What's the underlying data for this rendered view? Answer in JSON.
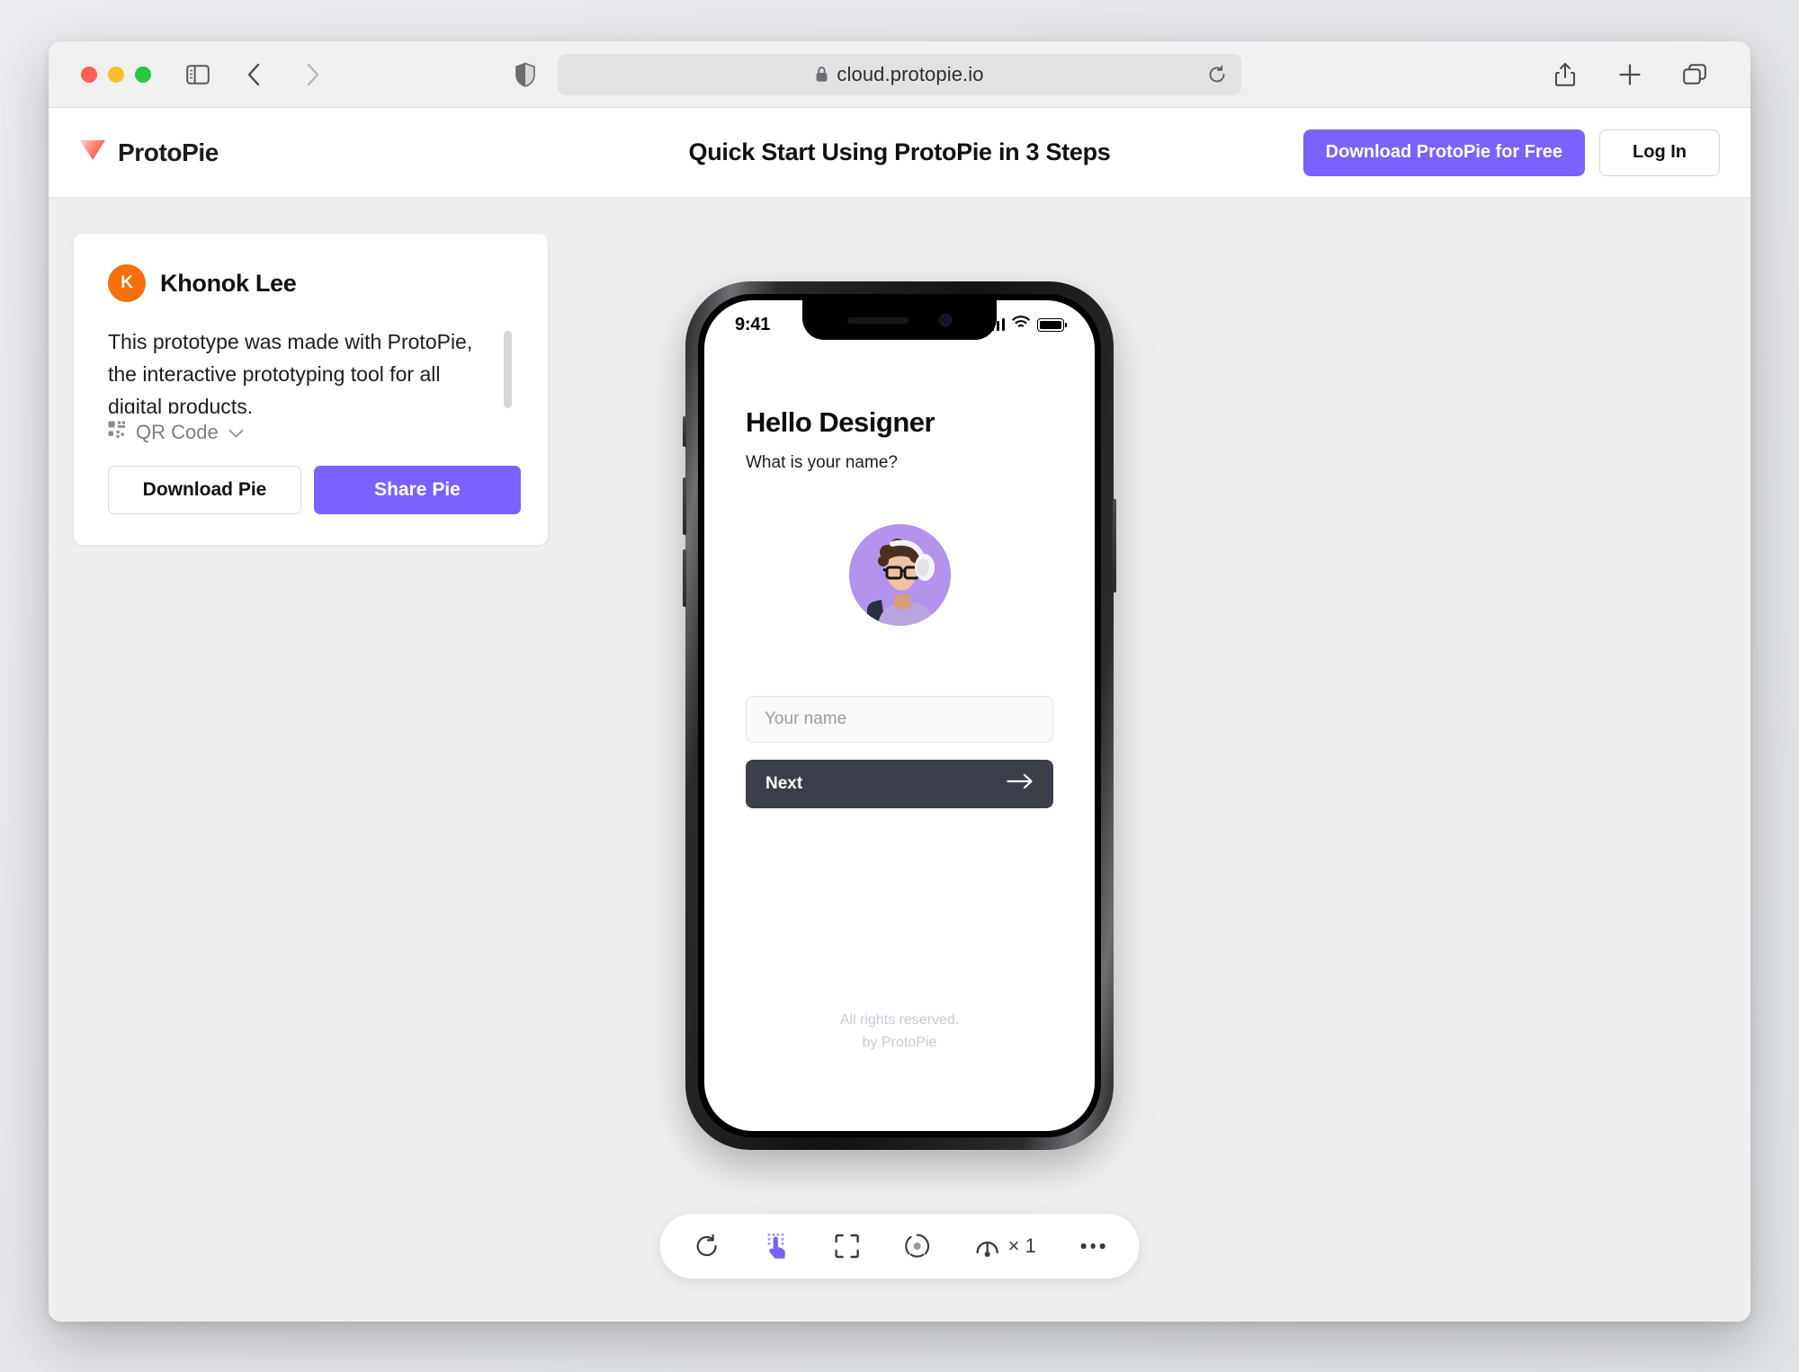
{
  "browser": {
    "url": "cloud.protopie.io",
    "icons": {
      "sidebar": "sidebar-toggle-icon",
      "back": "back-arrow-icon",
      "forward": "forward-arrow-icon",
      "shield": "privacy-shield-icon",
      "lock": "lock-icon",
      "reload": "reload-icon",
      "share": "share-icon",
      "new_tab": "plus-icon",
      "tabs": "tab-overview-icon"
    },
    "traffic_lights": [
      "close",
      "minimize",
      "maximize"
    ]
  },
  "header": {
    "brand": "ProtoPie",
    "title": "Quick Start Using ProtoPie in 3 Steps",
    "download_label": "Download ProtoPie for Free",
    "login_label": "Log In"
  },
  "card": {
    "avatar_initial": "K",
    "username": "Khonok Lee",
    "description": "This prototype was made with ProtoPie, the interactive prototyping tool for all digital products.",
    "qr_label": "QR Code",
    "download_pie": "Download Pie",
    "share_pie": "Share Pie"
  },
  "phone": {
    "status": {
      "time": "9:41",
      "signal": "cellular-signal-icon",
      "wifi": "wifi-icon",
      "battery": "battery-icon"
    },
    "screen": {
      "heading": "Hello Designer",
      "subheading": "What is your name?",
      "avatar_alt": "designer-avatar-illustration",
      "input_placeholder": "Your name",
      "input_value": "",
      "next_label": "Next",
      "footer_line1": "All rights reserved.",
      "footer_line2": "by ProtoPie"
    }
  },
  "player_toolbar": {
    "reload": "reload-icon",
    "touch": "touch-pointer-icon",
    "fullscreen": "fullscreen-icon",
    "focus": "focus-target-icon",
    "speed_icon": "speed-gauge-icon",
    "speed_label": "× 1",
    "more": "more-options-icon"
  },
  "colors": {
    "accent_purple": "#7b61ff",
    "avatar_orange": "#f4700b",
    "brand_red": "#f4564a",
    "next_dark": "#3b3f49",
    "page_bg": "#efefef"
  }
}
